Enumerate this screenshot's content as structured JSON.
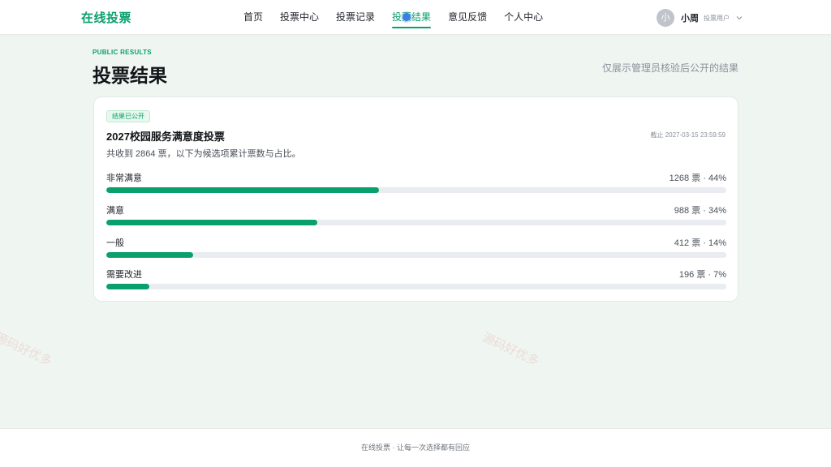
{
  "header": {
    "brand": "在线投票",
    "nav": [
      {
        "label": "首页",
        "active": false
      },
      {
        "label": "投票中心",
        "active": false
      },
      {
        "label": "投票记录",
        "active": false
      },
      {
        "label": "投票结果",
        "active": true
      },
      {
        "label": "意见反馈",
        "active": false
      },
      {
        "label": "个人中心",
        "active": false
      }
    ],
    "user": {
      "avatar_text": "小",
      "name": "小周",
      "role": "投票用户"
    }
  },
  "page": {
    "eyebrow": "PUBLIC RESULTS",
    "title": "投票结果",
    "note": "仅展示管理员核验后公开的结果"
  },
  "poll": {
    "badge": "结果已公开",
    "title": "2027校园服务满意度投票",
    "deadline": "截止 2027-03-15 23:59:59",
    "summary": "共收到 2864 票，以下为候选项累计票数与占比。",
    "options": [
      {
        "label": "非常满意",
        "stat": "1268 票 · 44%",
        "percent": 44
      },
      {
        "label": "满意",
        "stat": "988 票 · 34%",
        "percent": 34
      },
      {
        "label": "一般",
        "stat": "412 票 · 14%",
        "percent": 14
      },
      {
        "label": "需要改进",
        "stat": "196 票 · 7%",
        "percent": 7
      }
    ]
  },
  "footer": {
    "text": "在线投票 · 让每一次选择都有回应"
  },
  "watermark": "源码好优多",
  "colors": {
    "accent": "#0aa06e",
    "track": "#e9edf1",
    "background": "#eff6f1"
  }
}
